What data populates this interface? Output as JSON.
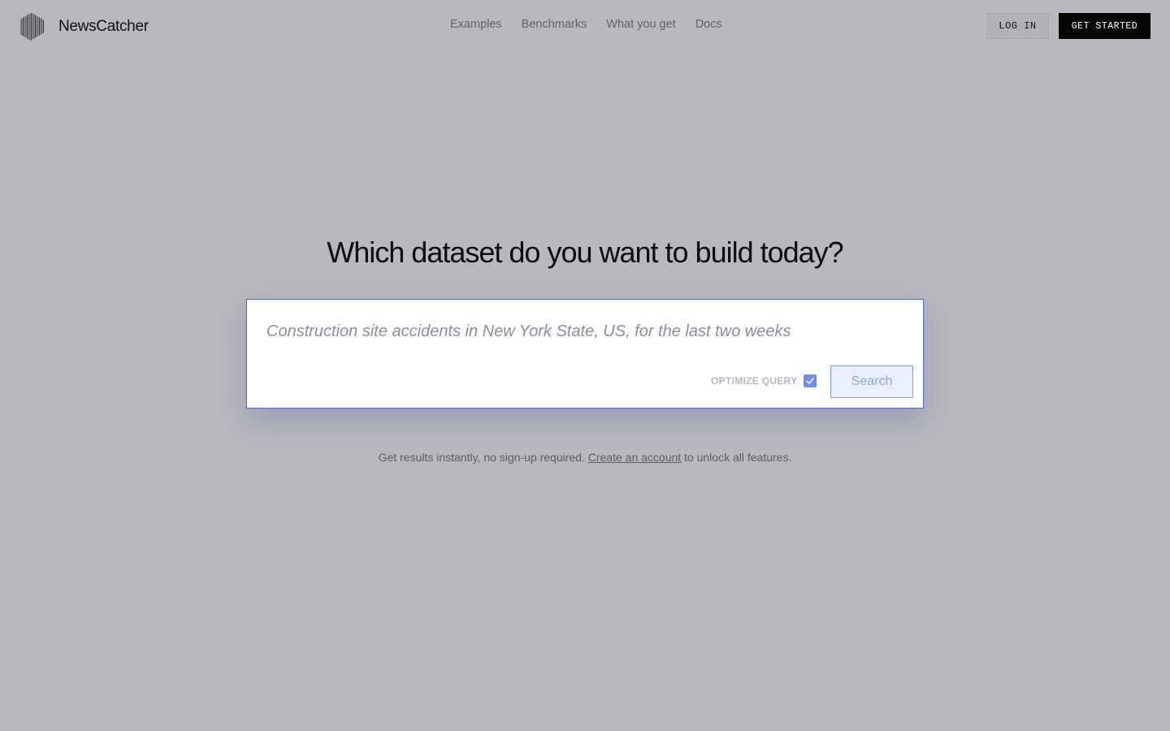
{
  "brand": {
    "name": "NewsCatcher",
    "logo_icon": "striped-cube-logo"
  },
  "nav": {
    "items": [
      {
        "label": "Examples"
      },
      {
        "label": "Benchmarks"
      },
      {
        "label": "What you get"
      },
      {
        "label": "Docs"
      }
    ]
  },
  "header": {
    "login_label": "LOG IN",
    "get_started_label": "GET STARTED"
  },
  "hero": {
    "title": "Which dataset do you want to build today?"
  },
  "search": {
    "value": "",
    "placeholder": "Construction site accidents in New York State, US, for the last two weeks",
    "optimize_label": "OPTIMIZE QUERY",
    "optimize_checked": true,
    "button_label": "Search"
  },
  "footer_note": {
    "text_before": "Get results instantly, no sign-up required. ",
    "link_text": "Create an account",
    "text_after": " to unlock all features."
  },
  "colors": {
    "background": "#b8b9bd",
    "accent": "#5a63c8",
    "checkbox": "#6f8af1",
    "primary_button": "#050505"
  }
}
